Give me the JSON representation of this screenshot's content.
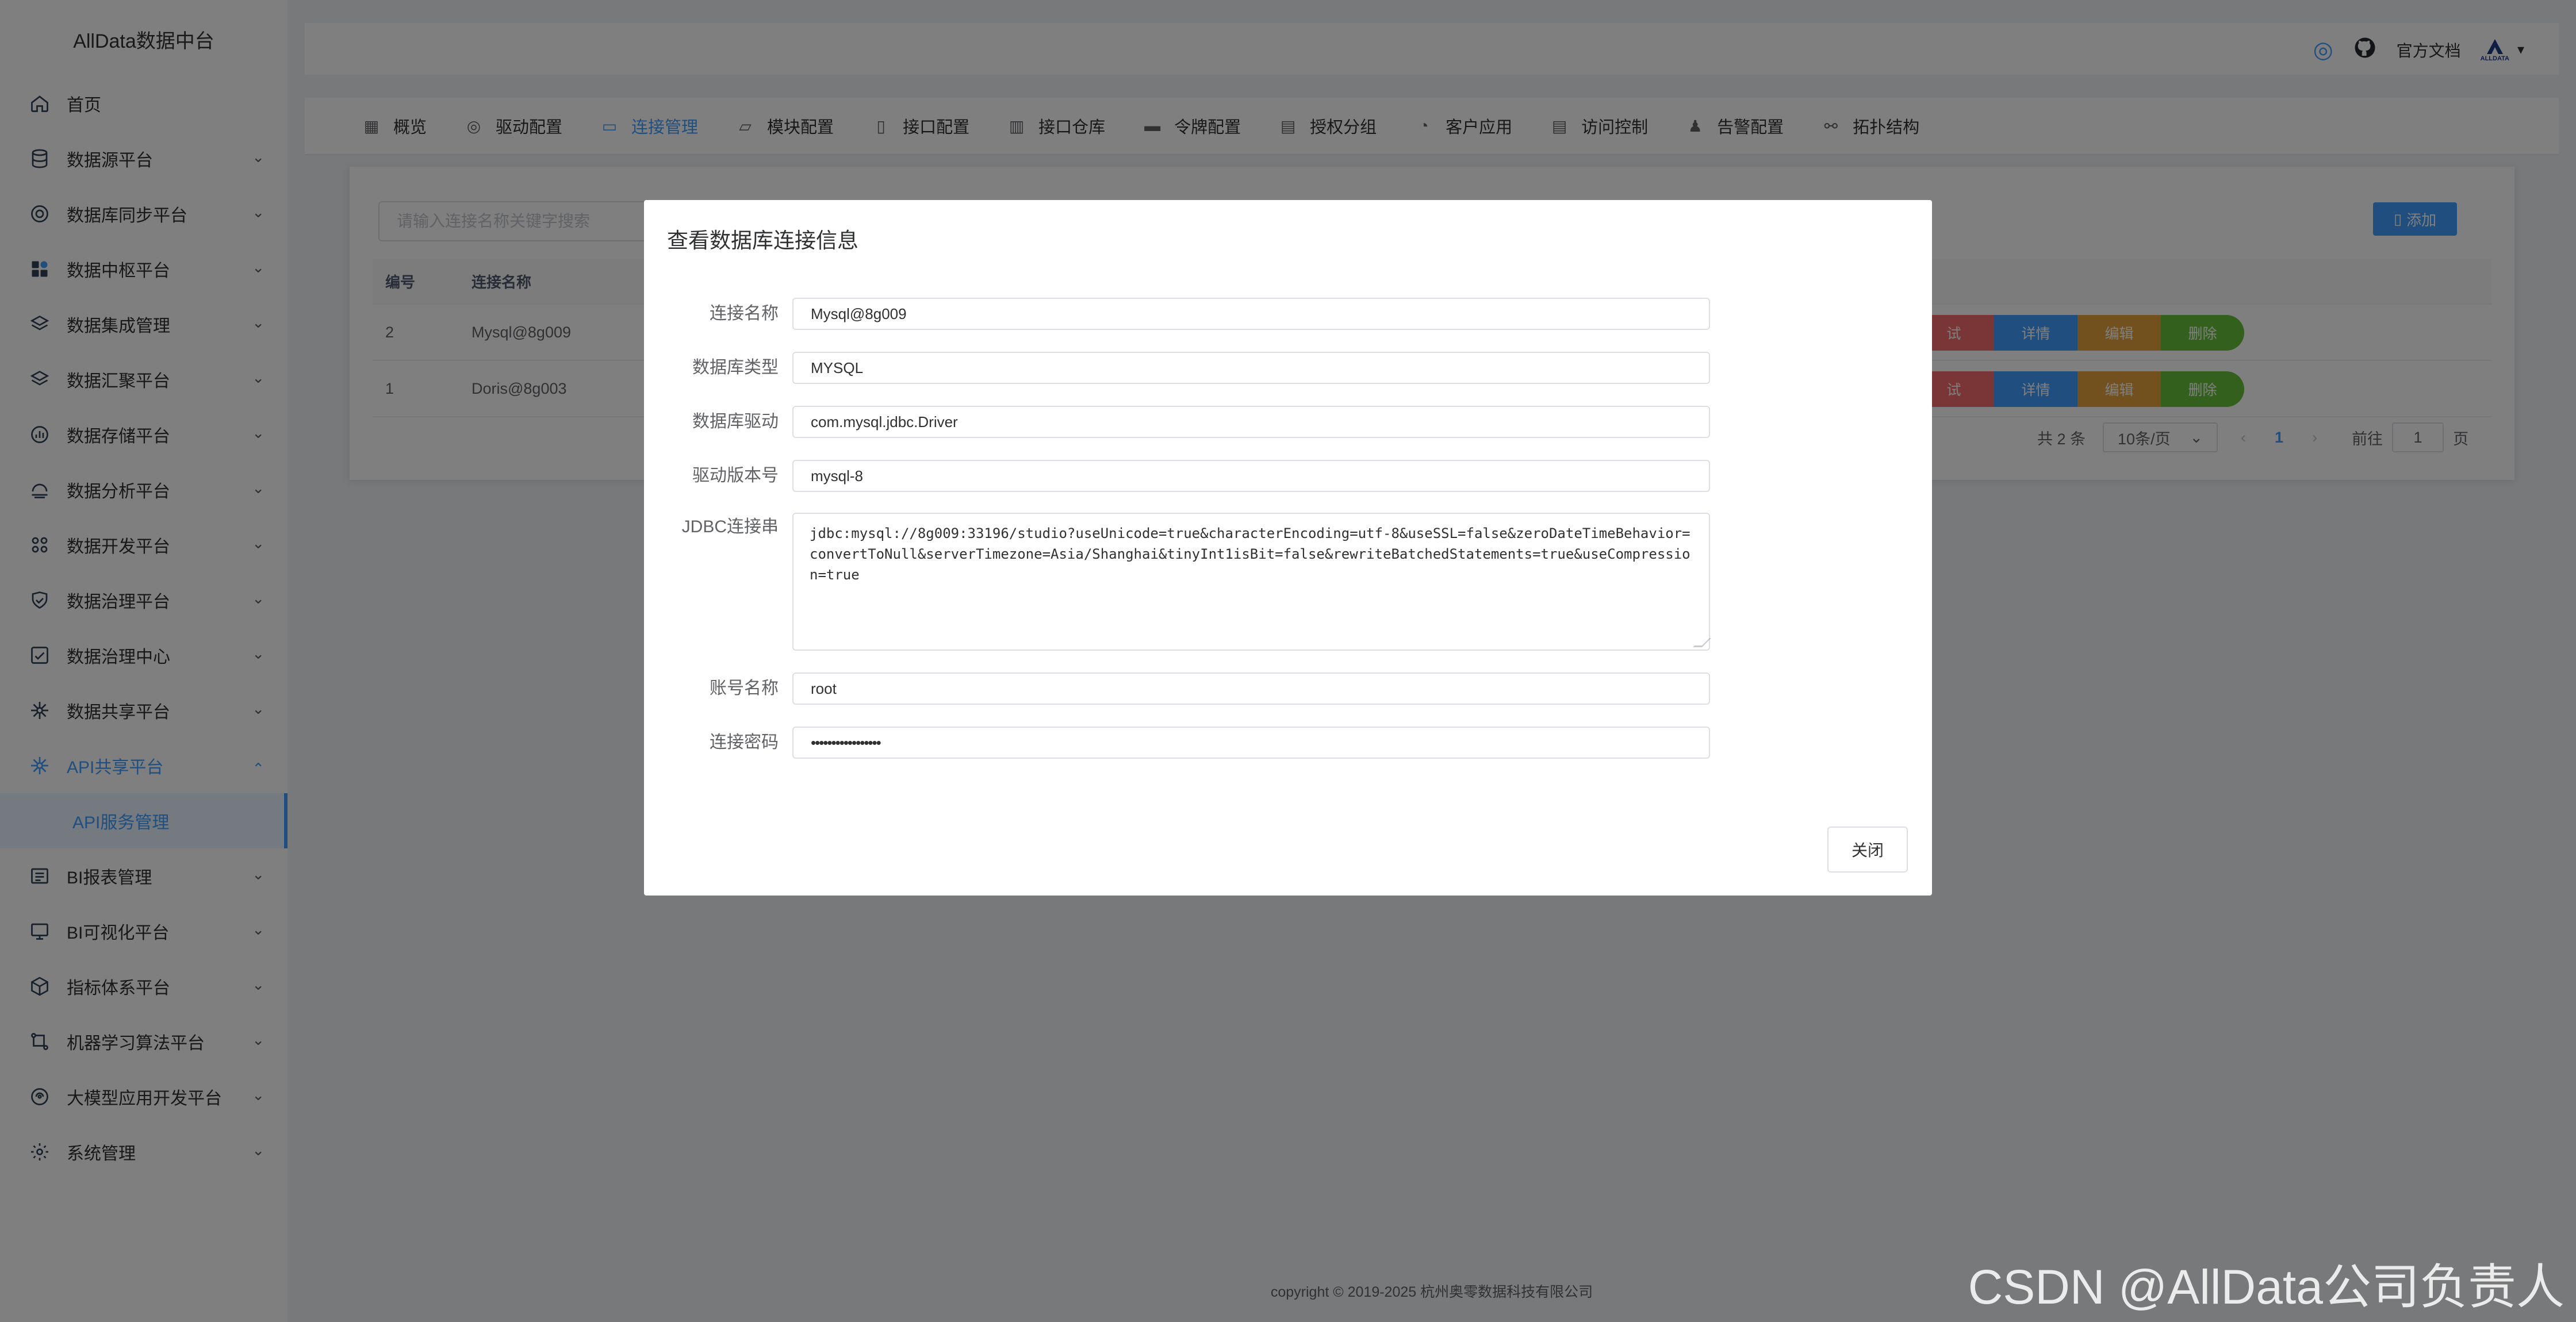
{
  "app_title": "AllData数据中台",
  "sidebar": {
    "items": [
      {
        "label": "首页",
        "icon": "home-icon",
        "has_children": false
      },
      {
        "label": "数据源平台",
        "icon": "database-icon",
        "has_children": true
      },
      {
        "label": "数据库同步平台",
        "icon": "sync-icon",
        "has_children": true
      },
      {
        "label": "数据中枢平台",
        "icon": "hub-icon",
        "has_children": true
      },
      {
        "label": "数据集成管理",
        "icon": "layers-icon",
        "has_children": true
      },
      {
        "label": "数据汇聚平台",
        "icon": "layers-icon",
        "has_children": true
      },
      {
        "label": "数据存储平台",
        "icon": "storage-icon",
        "has_children": true
      },
      {
        "label": "数据分析平台",
        "icon": "analysis-icon",
        "has_children": true
      },
      {
        "label": "数据开发平台",
        "icon": "grid-icon",
        "has_children": true
      },
      {
        "label": "数据治理平台",
        "icon": "governance-icon",
        "has_children": true
      },
      {
        "label": "数据治理中心",
        "icon": "checkbox-icon",
        "has_children": true
      },
      {
        "label": "数据共享平台",
        "icon": "share-icon",
        "has_children": true
      },
      {
        "label": "API共享平台",
        "icon": "api-icon",
        "has_children": true,
        "expanded": true
      },
      {
        "label": "BI报表管理",
        "icon": "report-icon",
        "has_children": true
      },
      {
        "label": "BI可视化平台",
        "icon": "monitor-icon",
        "has_children": true
      },
      {
        "label": "指标体系平台",
        "icon": "cube-icon",
        "has_children": true
      },
      {
        "label": "机器学习算法平台",
        "icon": "ml-icon",
        "has_children": true
      },
      {
        "label": "大模型应用开发平台",
        "icon": "llm-icon",
        "has_children": true
      },
      {
        "label": "系统管理",
        "icon": "settings-icon",
        "has_children": true
      }
    ],
    "active_sub_item": "API服务管理"
  },
  "navbar": {
    "docs_label": "官方文档",
    "logo_text": "ALLDATA",
    "dropdown_caret": "▾"
  },
  "tabs": [
    {
      "label": "概览",
      "icon": "overview-icon",
      "active": false
    },
    {
      "label": "驱动配置",
      "icon": "driver-icon",
      "active": false
    },
    {
      "label": "连接管理",
      "icon": "connection-icon",
      "active": true
    },
    {
      "label": "模块配置",
      "icon": "folder-icon",
      "active": false
    },
    {
      "label": "接口配置",
      "icon": "document-icon",
      "active": false
    },
    {
      "label": "接口仓库",
      "icon": "building-icon",
      "active": false
    },
    {
      "label": "令牌配置",
      "icon": "monitor-icon",
      "active": false
    },
    {
      "label": "授权分组",
      "icon": "list-icon",
      "active": false
    },
    {
      "label": "客户应用",
      "icon": "pie-icon",
      "active": false
    },
    {
      "label": "访问控制",
      "icon": "list-icon",
      "active": false
    },
    {
      "label": "告警配置",
      "icon": "bell-icon",
      "active": false
    },
    {
      "label": "拓扑结构",
      "icon": "link-icon",
      "active": false
    }
  ],
  "list": {
    "search_placeholder": "请输入连接名称关键字搜索",
    "add_label": "添加",
    "columns": [
      "编号",
      "连接名称"
    ],
    "rows": [
      {
        "id": "2",
        "name": "Mysql@8g009"
      },
      {
        "id": "1",
        "name": "Doris@8g003"
      }
    ],
    "actions": {
      "test": "试",
      "detail": "详情",
      "edit": "编辑",
      "delete": "删除"
    },
    "pagination": {
      "total": "共 2 条",
      "page_size": "10条/页",
      "current": "1",
      "goto_prefix": "前往",
      "goto_value": "1",
      "goto_suffix": "页"
    }
  },
  "dialog": {
    "title": "查看数据库连接信息",
    "fields": {
      "conn_name_label": "连接名称",
      "conn_name": "Mysql@8g009",
      "db_type_label": "数据库类型",
      "db_type": "MYSQL",
      "driver_label": "数据库驱动",
      "driver": "com.mysql.jdbc.Driver",
      "driver_version_label": "驱动版本号",
      "driver_version": "mysql-8",
      "jdbc_label": "JDBC连接串",
      "jdbc_url": "jdbc:mysql://8g009:33196/studio?useUnicode=true&characterEncoding=utf-8&useSSL=false&zeroDateTimeBehavior=convertToNull&serverTimezone=Asia/Shanghai&tinyInt1isBit=false&rewriteBatchedStatements=true&useCompression=true",
      "username_label": "账号名称",
      "username": "root",
      "password_label": "连接密码",
      "password": "•••••••••••••••••"
    },
    "close_label": "关闭"
  },
  "footer": "copyright © 2019-2025 杭州奥零数据科技有限公司",
  "watermark": "CSDN @AllData公司负责人"
}
